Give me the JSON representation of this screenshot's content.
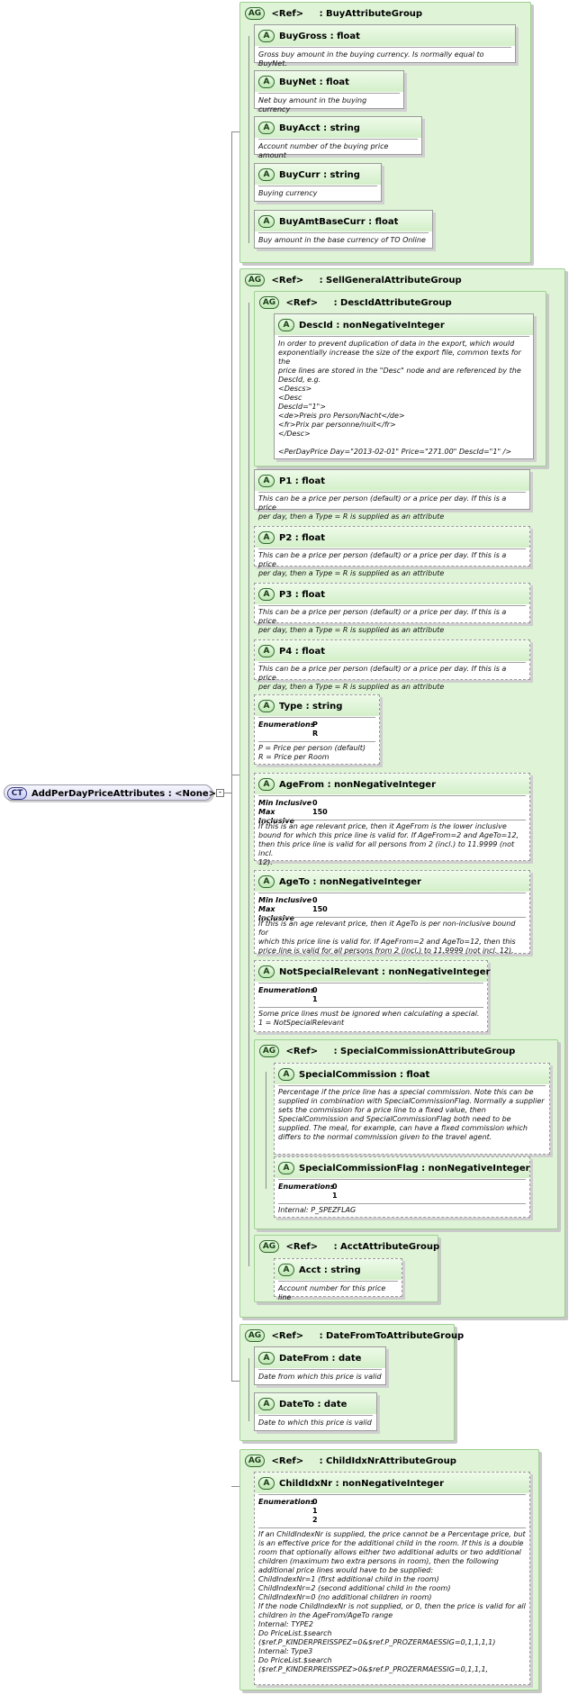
{
  "root": {
    "badge": "CT",
    "title": "AddPerDayPriceAttributes : <None>"
  },
  "ref_label": "<Ref>",
  "groups": {
    "buy": {
      "badge": "AG",
      "name": ": BuyAttributeGroup"
    },
    "sell": {
      "badge": "AG",
      "name": ": SellGeneralAttributeGroup"
    },
    "descid": {
      "badge": "AG",
      "name": ": DescIdAttributeGroup"
    },
    "specialcommission": {
      "badge": "AG",
      "name": ": SpecialCommissionAttributeGroup"
    },
    "acct": {
      "badge": "AG",
      "name": ": AcctAttributeGroup"
    },
    "datefromto": {
      "badge": "AG",
      "name": ": DateFromToAttributeGroup"
    },
    "childidxnr": {
      "badge": "AG",
      "name": ": ChildIdxNrAttributeGroup"
    }
  },
  "attrs": {
    "buygross": {
      "badge": "A",
      "name": "BuyGross : float",
      "desc": "Gross buy amount in the buying currency. Is normally equal to BuyNet."
    },
    "buynet": {
      "badge": "A",
      "name": "BuyNet  : float",
      "desc": "Net buy amount in the buying currency"
    },
    "buyacct": {
      "badge": "A",
      "name": "BuyAcct : string",
      "desc": "Account number of the buying price amount"
    },
    "buycurr": {
      "badge": "A",
      "name": "BuyCurr : string",
      "desc": "Buying currency"
    },
    "buyamtbasecurr": {
      "badge": "A",
      "name": "BuyAmtBaseCurr : float",
      "desc": "Buy amount in the base currency of TO Online"
    },
    "descid": {
      "badge": "A",
      "name": "DescId    : nonNegativeInteger",
      "desc": "In order to prevent duplication of data in the export, which would\nexponentially increase the size of the export file, common texts for the\nprice lines are stored in the \"Desc\" node and are referenced by the\nDescId, e.g.\n<Descs>\n<Desc\nDescId=\"1\">\n<de>Preis pro Person/Nacht</de>\n<fr>Prix par personne/nuit</fr>\n</Desc>\n\n<PerDayPrice Day=\"2013-02-01\" Price=\"271.00\" DescId=\"1\" />"
    },
    "p1": {
      "badge": "A",
      "name": "P1          : float",
      "desc": "This can be a price per person (default) or a price per day. If this is a price\nper day, then a Type = R is supplied as an attribute"
    },
    "p2": {
      "badge": "A",
      "name": "P2          : float",
      "desc": "This can be a price per person (default) or a price per day. If this is a price\nper day, then a Type = R is supplied as an attribute"
    },
    "p3": {
      "badge": "A",
      "name": "P3          : float",
      "desc": "This can be a price per person (default) or a price per day. If this is a price\nper day, then a Type = R is supplied as an attribute"
    },
    "p4": {
      "badge": "A",
      "name": "P4          : float",
      "desc": "This can be a price per person (default) or a price per day. If this is a price\nper day, then a Type = R is supplied as an attribute"
    },
    "type": {
      "badge": "A",
      "name": "Type       : string",
      "enum_key": "Enumerations",
      "enum_vals": "P\nR",
      "desc": "P = Price per person (default)\nR = Price per Room"
    },
    "agefrom": {
      "badge": "A",
      "name": "AgeFrom : nonNegativeInteger",
      "k1": "Min Inclusive",
      "v1": "0",
      "k2": "Max Inclusive",
      "v2": "150",
      "desc": "If this is an age relevant price, then it AgeFrom is the lower inclusive\nbound for which this price line is valid for. If AgeFrom=2 and AgeTo=12,\nthen this price line is valid for all persons from 2 (incl.) to 11.9999 (not incl.\n12)."
    },
    "ageto": {
      "badge": "A",
      "name": "AgeTo    : nonNegativeInteger",
      "k1": "Min Inclusive",
      "v1": "0",
      "k2": "Max Inclusive",
      "v2": "150",
      "desc": "If this is an age relevant price, then it AgeTo is per non-inclusive bound for\nwhich this price line is valid for. If AgeFrom=2 and AgeTo=12, then this\nprice line is valid for all persons from 2 (incl.) to 11.9999 (not incl. 12)."
    },
    "notspecialrelevant": {
      "badge": "A",
      "name": "NotSpecialRelevant : nonNegativeInteger",
      "enum_key": "Enumerations",
      "enum_vals": "0\n1",
      "desc": "Some price lines must be ignored when calculating a special.\n1 = NotSpecialRelevant"
    },
    "specialcommission": {
      "badge": "A",
      "name": "SpecialCommission : float",
      "desc": "Percentage if the price line has a special commission. Note this can be\nsupplied in combination with SpecialCommissionFlag. Normally a supplier\nsets the commission for a price line to a fixed value, then\nSpecialCommission and SpecialCommissionFlag both need to be\nsupplied. The meal, for example, can have a fixed commission which\ndiffers to the normal commission given to the travel agent."
    },
    "specialcommissionflag": {
      "badge": "A",
      "name": "SpecialCommissionFlag : nonNegativeInteger",
      "enum_key": "Enumerations",
      "enum_vals": "0\n1",
      "desc": "Internal: P_SPEZFLAG"
    },
    "acct": {
      "badge": "A",
      "name": "Acct       : string",
      "desc": "Account number for this price line"
    },
    "datefrom": {
      "badge": "A",
      "name": "DateFrom : date",
      "desc": "Date from which this price is valid"
    },
    "dateto": {
      "badge": "A",
      "name": "DateTo    : date",
      "desc": "Date to which this price is valid"
    },
    "childidxnr": {
      "badge": "A",
      "name": "ChildIdxNr : nonNegativeInteger",
      "enum_key": "Enumerations",
      "enum_vals": "0\n1\n2",
      "desc": "If an ChildIndexNr is supplied, the price cannot be a Percentage price, but\nis an effective price for the additional child in the room. If this is a double\nroom that optionally allows either two additional adults or two additional\nchildren (maximum two extra persons in room), then the following\nadditional price lines would have to be supplied:\nChildIndexNr=1 (first additional child in the room)\nChildIndexNr=2 (second additional child in the room)\nChildIndexNr=0 (no additional children in room)\nIf the node ChildIndexNr is not supplied, or 0, then the price is valid for all\nchildren in the AgeFrom/AgeTo range\nInternal: TYPE2\nDo PriceList.$search\n($ref.P_KINDERPREISSPEZ=0&$ref.P_PROZERMAESSIG=0,1,1,1,1)\nInternal: Type3\nDo PriceList.$search\n($ref.P_KINDERPREISSPEZ>0&$ref.P_PROZERMAESSIG=0,1,1,1,"
    }
  }
}
